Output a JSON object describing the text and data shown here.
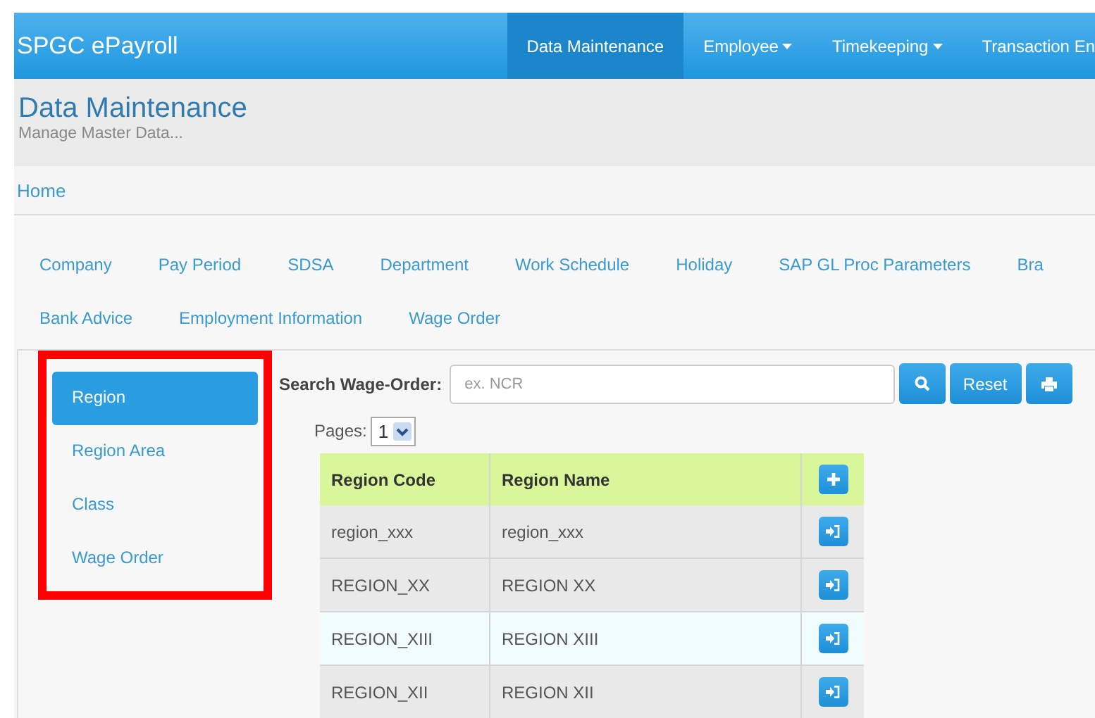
{
  "navbar": {
    "brand": "SPGC ePayroll",
    "items": [
      {
        "label": "Data Maintenance",
        "selected": true,
        "dropdown": false
      },
      {
        "label": "Employee",
        "selected": false,
        "dropdown": true
      },
      {
        "label": "Timekeeping",
        "selected": false,
        "dropdown": true
      },
      {
        "label": "Transaction En",
        "selected": false,
        "dropdown": false
      }
    ]
  },
  "header": {
    "title": "Data Maintenance",
    "subtitle": "Manage Master Data..."
  },
  "breadcrumb": [
    "Home"
  ],
  "tabs": [
    [
      "Company",
      "Pay Period",
      "SDSA",
      "Department",
      "Work Schedule",
      "Holiday",
      "SAP GL Proc Parameters",
      "Bra"
    ],
    [
      "Bank Advice",
      "Employment Information",
      "Wage Order"
    ]
  ],
  "sidebar": {
    "outlined": true,
    "items": [
      {
        "label": "Region",
        "selected": true
      },
      {
        "label": "Region Area",
        "selected": false
      },
      {
        "label": "Class",
        "selected": false
      },
      {
        "label": "Wage Order",
        "selected": false
      }
    ]
  },
  "search": {
    "label": "Search Wage-Order:",
    "placeholder": "ex. NCR",
    "reset": "Reset"
  },
  "pages": {
    "label": "Pages:",
    "value": "1"
  },
  "table": {
    "columns": [
      "Region Code",
      "Region Name"
    ],
    "rows": [
      {
        "cells": [
          "region_xxx",
          "region_xxx"
        ],
        "highlighted": false
      },
      {
        "cells": [
          "REGION_XX",
          "REGION XX"
        ],
        "highlighted": false
      },
      {
        "cells": [
          "REGION_XIII",
          "REGION XIII"
        ],
        "highlighted": true
      },
      {
        "cells": [
          "REGION_XII",
          "REGION XII"
        ],
        "highlighted": false
      }
    ]
  }
}
